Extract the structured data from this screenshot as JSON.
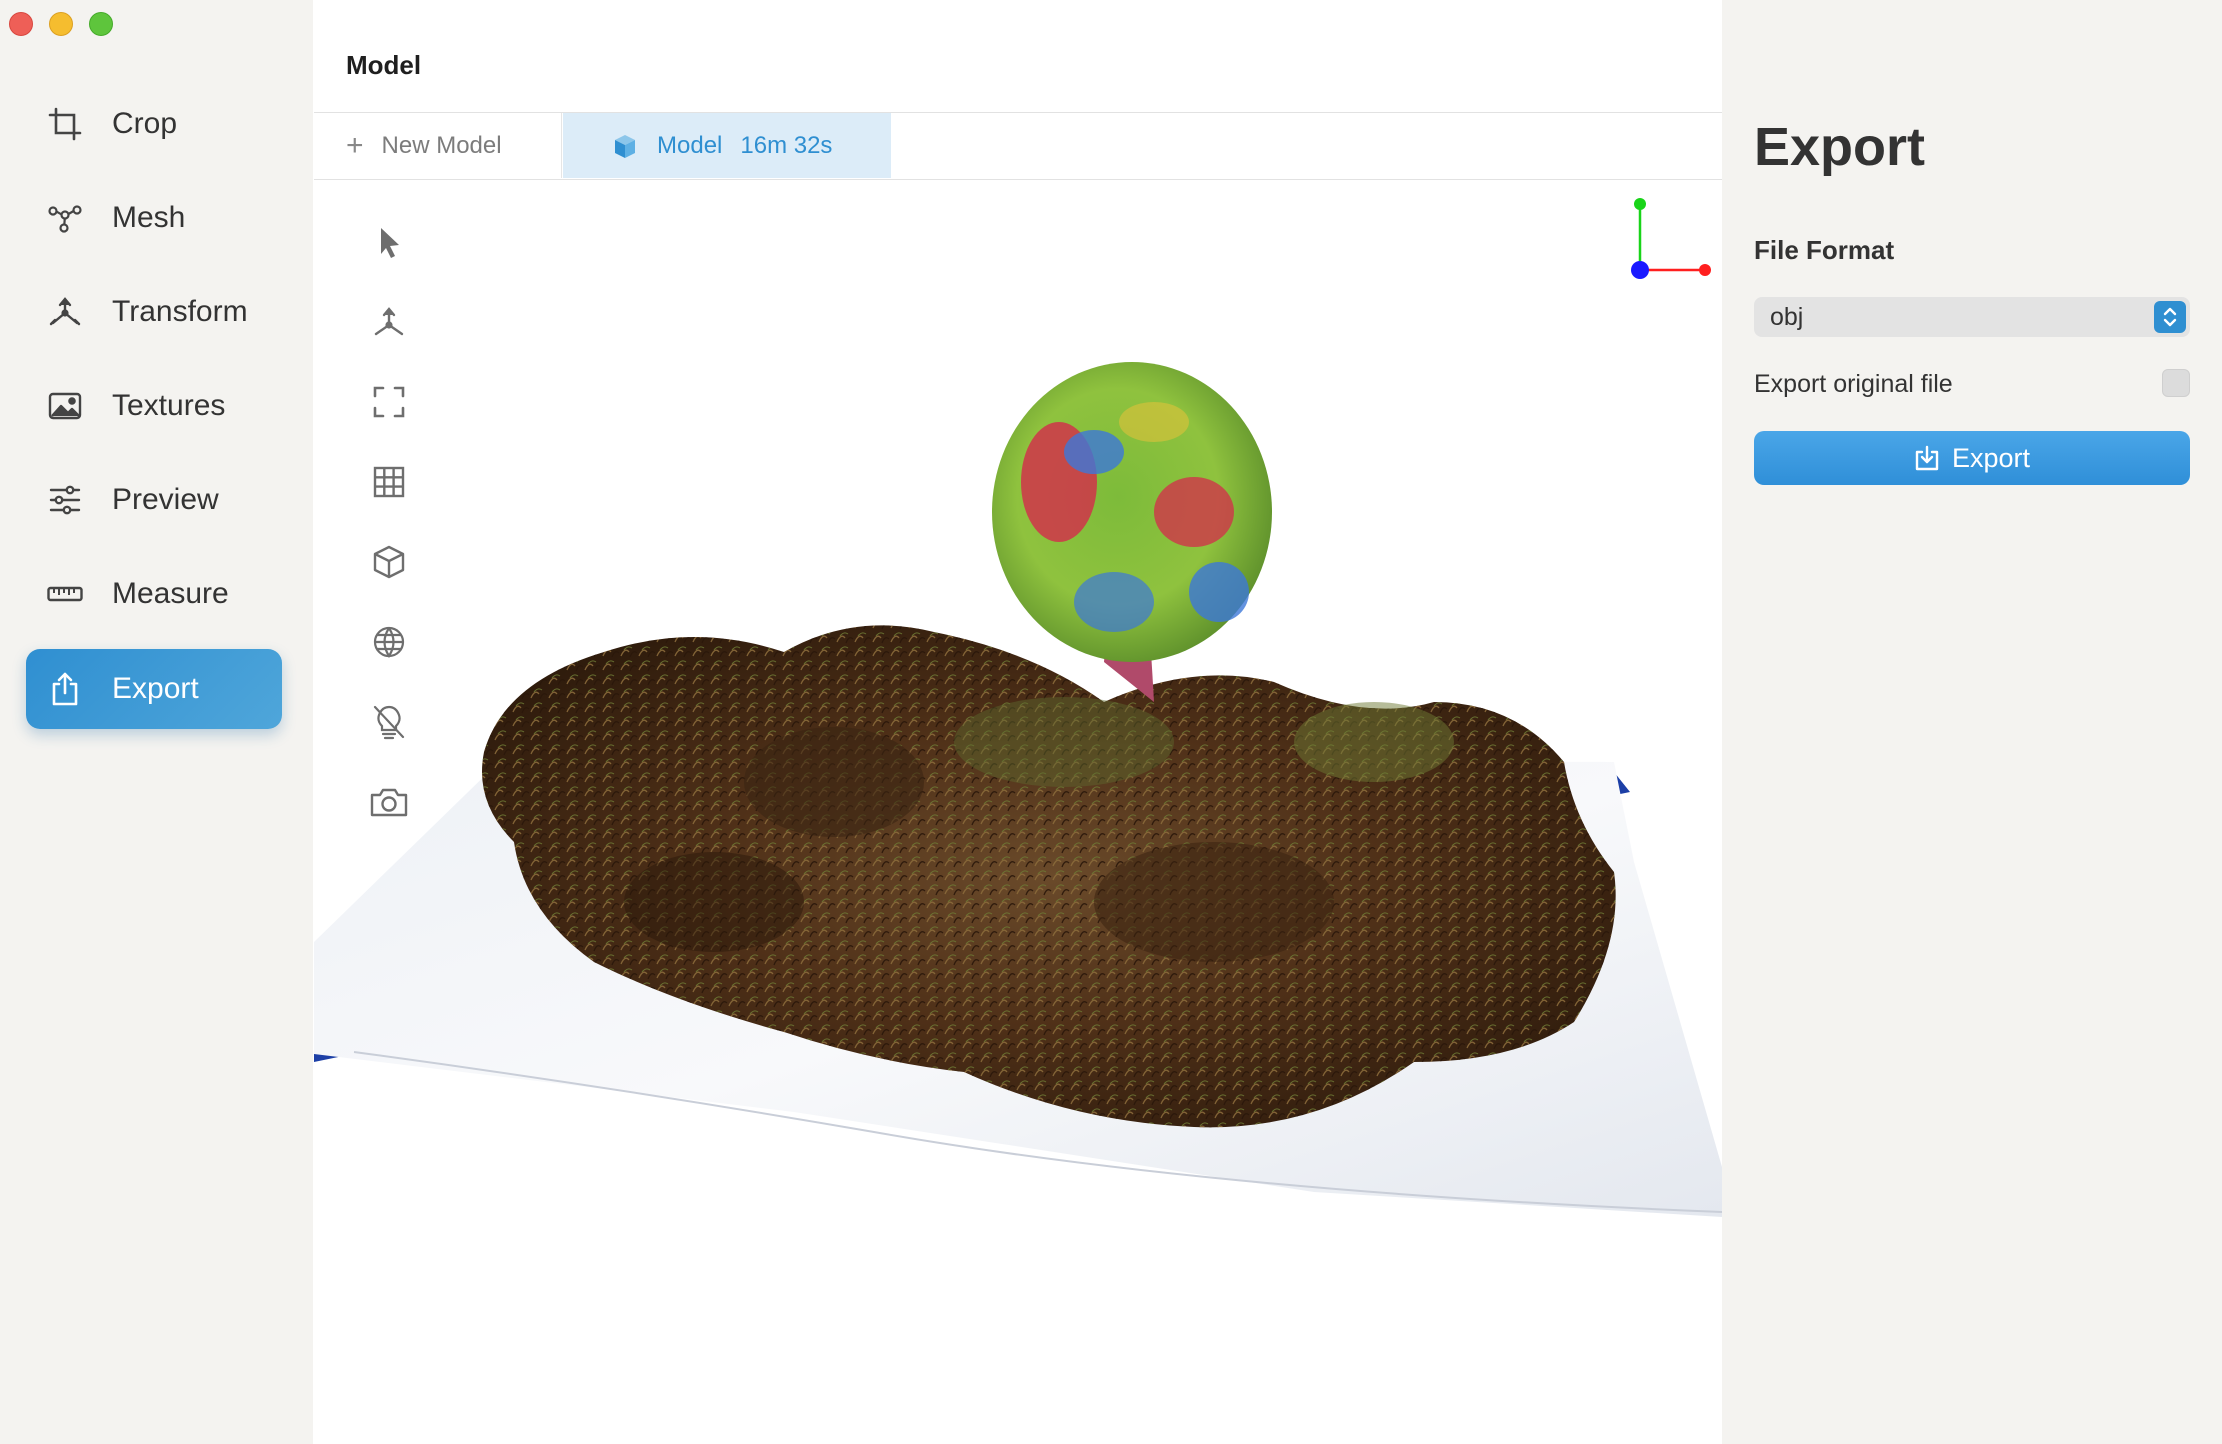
{
  "window": {
    "controls": [
      "close",
      "minimize",
      "zoom"
    ]
  },
  "sidebar": {
    "items": [
      {
        "label": "Crop",
        "icon": "crop-icon",
        "active": false
      },
      {
        "label": "Mesh",
        "icon": "mesh-icon",
        "active": false
      },
      {
        "label": "Transform",
        "icon": "transform-icon",
        "active": false
      },
      {
        "label": "Textures",
        "icon": "image-icon",
        "active": false
      },
      {
        "label": "Preview",
        "icon": "sliders-icon",
        "active": false
      },
      {
        "label": "Measure",
        "icon": "ruler-icon",
        "active": false
      },
      {
        "label": "Export",
        "icon": "share-icon",
        "active": true
      }
    ]
  },
  "main": {
    "title": "Model",
    "tabs": {
      "new_label": "New Model",
      "active_label": "Model",
      "active_time": "16m 32s"
    },
    "tools": [
      "select-pointer-icon",
      "axes-gizmo-icon",
      "fit-frame-icon",
      "grid-icon",
      "cube-icon",
      "globe-icon",
      "light-off-icon",
      "camera-icon"
    ],
    "axis_colors": {
      "x": "#ff1f1f",
      "y": "#19d419",
      "z": "#1a1aff"
    }
  },
  "export_panel": {
    "title": "Export",
    "file_format_label": "File Format",
    "file_format_value": "obj",
    "export_original_label": "Export original file",
    "export_original_checked": false,
    "export_button_label": "Export"
  },
  "colors": {
    "accent": "#2f8fd1",
    "sidebar_bg": "#f4f3f0",
    "tab_active_bg": "#dcecf8"
  }
}
